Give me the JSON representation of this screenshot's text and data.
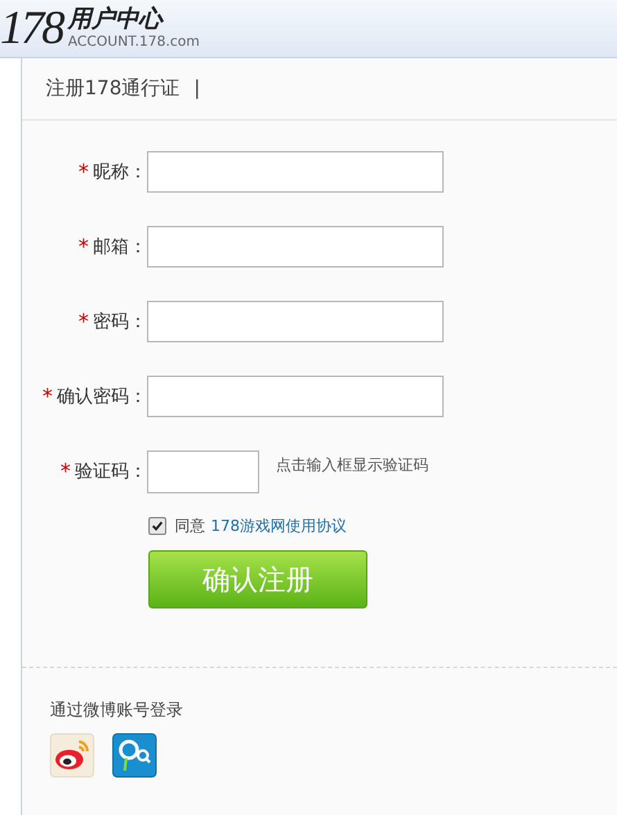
{
  "header": {
    "logo_number": "178",
    "logo_title": "用户中心",
    "logo_domain": "ACCOUNT.178.com"
  },
  "section_title": "注册178通行证",
  "title_separator": "|",
  "fields": [
    {
      "label": "昵称：",
      "required": true,
      "kind": "text"
    },
    {
      "label": "邮箱：",
      "required": true,
      "kind": "text"
    },
    {
      "label": "密码：",
      "required": true,
      "kind": "password"
    },
    {
      "label": "确认密码：",
      "required": true,
      "kind": "password"
    },
    {
      "label": "验证码：",
      "required": true,
      "kind": "captcha",
      "hint": "点击输入框显示验证码"
    }
  ],
  "required_mark": "*",
  "agreement": {
    "checked": true,
    "text": "同意",
    "link": "178游戏网使用协议"
  },
  "submit": "确认注册",
  "social": {
    "label": "通过微博账号登录"
  }
}
